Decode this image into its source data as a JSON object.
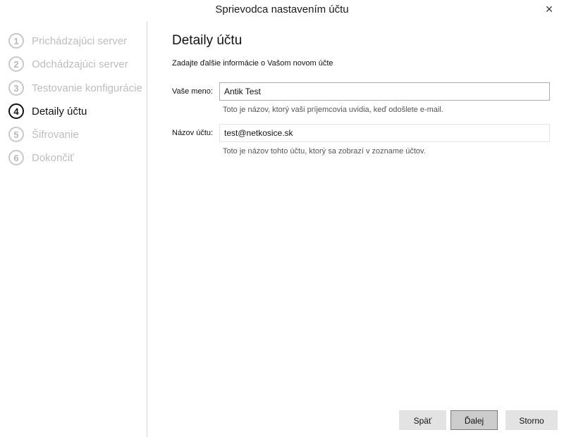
{
  "window": {
    "title": "Sprievodca nastavením účtu",
    "close_glyph": "×"
  },
  "steps": [
    {
      "number": "1",
      "label": "Prichádzajúci server",
      "state": "inactive"
    },
    {
      "number": "2",
      "label": "Odchádzajúci server",
      "state": "inactive"
    },
    {
      "number": "3",
      "label": "Testovanie konfigurácie",
      "state": "inactive"
    },
    {
      "number": "4",
      "label": "Detaily účtu",
      "state": "active"
    },
    {
      "number": "5",
      "label": "Šifrovanie",
      "state": "inactive"
    },
    {
      "number": "6",
      "label": "Dokončiť",
      "state": "inactive"
    }
  ],
  "content": {
    "heading": "Detaily účtu",
    "intro": "Zadajte ďalšie informácie o Vašom novom účte",
    "name_field": {
      "label": "Vaše meno:",
      "value": "Antik Test",
      "hint": "Toto je názov, ktorý vaši príjemcovia uvidia, keď odošlete e-mail."
    },
    "account_field": {
      "label": "Názov účtu:",
      "value": "test@netkosice.sk",
      "hint": "Toto je názov tohto účtu, ktorý sa zobrazí v zozname účtov."
    }
  },
  "buttons": {
    "back": "Späť",
    "next": "Ďalej",
    "cancel": "Storno"
  },
  "colors": {
    "active_step": "#111111",
    "inactive_step": "#bdbdbd",
    "button_bg": "#e3e3e3",
    "primary_button_bg": "#cccccc"
  }
}
